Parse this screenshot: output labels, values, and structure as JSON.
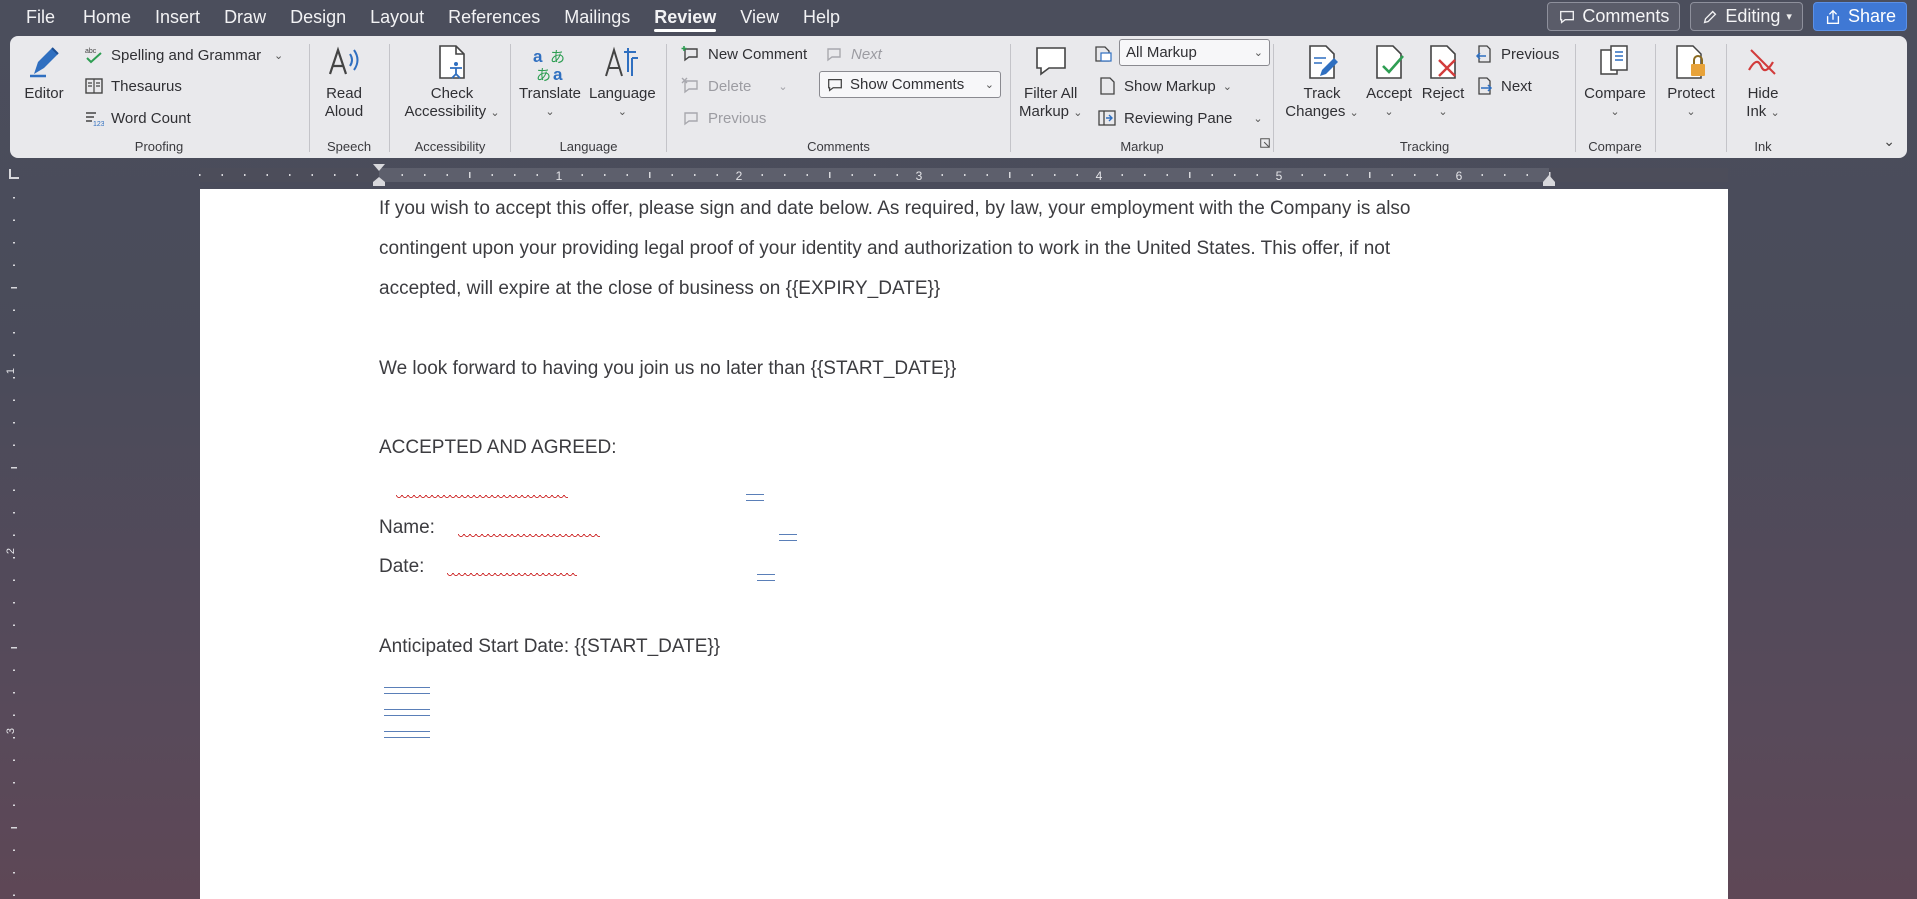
{
  "menu": {
    "items": [
      "File",
      "Home",
      "Insert",
      "Draw",
      "Design",
      "Layout",
      "References",
      "Mailings",
      "Review",
      "View",
      "Help"
    ],
    "active": "Review"
  },
  "top_right": {
    "comments": "Comments",
    "editing": "Editing",
    "share": "Share"
  },
  "ribbon": {
    "proofing": {
      "label": "Proofing",
      "editor": "Editor",
      "spelling": "Spelling and Grammar",
      "thesaurus": "Thesaurus",
      "word_count": "Word Count"
    },
    "speech": {
      "label": "Speech",
      "read_aloud_1": "Read",
      "read_aloud_2": "Aloud"
    },
    "accessibility": {
      "label": "Accessibility",
      "check_1": "Check",
      "check_2": "Accessibility"
    },
    "language": {
      "label": "Language",
      "translate": "Translate",
      "language": "Language"
    },
    "comments": {
      "label": "Comments",
      "new_comment": "New Comment",
      "delete": "Delete",
      "previous": "Previous",
      "next": "Next",
      "show_comments": "Show Comments"
    },
    "markup": {
      "label": "Markup",
      "filter_1": "Filter All",
      "filter_2": "Markup",
      "all_markup": "All Markup",
      "show_markup": "Show Markup",
      "reviewing_pane": "Reviewing Pane"
    },
    "tracking": {
      "label": "Tracking",
      "track_1": "Track",
      "track_2": "Changes",
      "accept": "Accept",
      "reject": "Reject",
      "previous": "Previous",
      "next": "Next"
    },
    "compare": {
      "label": "Compare",
      "compare": "Compare"
    },
    "protect": {
      "label": "",
      "protect": "Protect"
    },
    "ink": {
      "label": "Ink",
      "hide_1": "Hide",
      "hide_2": "Ink"
    }
  },
  "ruler": {
    "numbers": [
      "1",
      "2",
      "3",
      "4",
      "5",
      "6"
    ],
    "v_numbers": [
      "1",
      "2",
      "3"
    ]
  },
  "document": {
    "p1_line1": "If you wish to accept this offer, please sign and date below. As required, by law, your employment with the Company is also",
    "p1_line2": "contingent upon your providing legal proof of your identity and authorization to work in the United States. This offer, if not",
    "p1_line3": "accepted, will expire at the close of business on {{EXPIRY_DATE}}",
    "p2": "We look forward to having you join us no later than {{START_DATE}}",
    "p3": "ACCEPTED AND AGREED:",
    "name_label": "Name:",
    "date_label": "Date:",
    "p4": "Anticipated Start Date: {{START_DATE}}"
  },
  "colors": {
    "accent": "#3f78d4",
    "ribbon_bg": "#e9e9ec",
    "spell_error": "#d23b3b",
    "icon_blue": "#2f6fc0",
    "icon_green": "#2e9e53"
  }
}
